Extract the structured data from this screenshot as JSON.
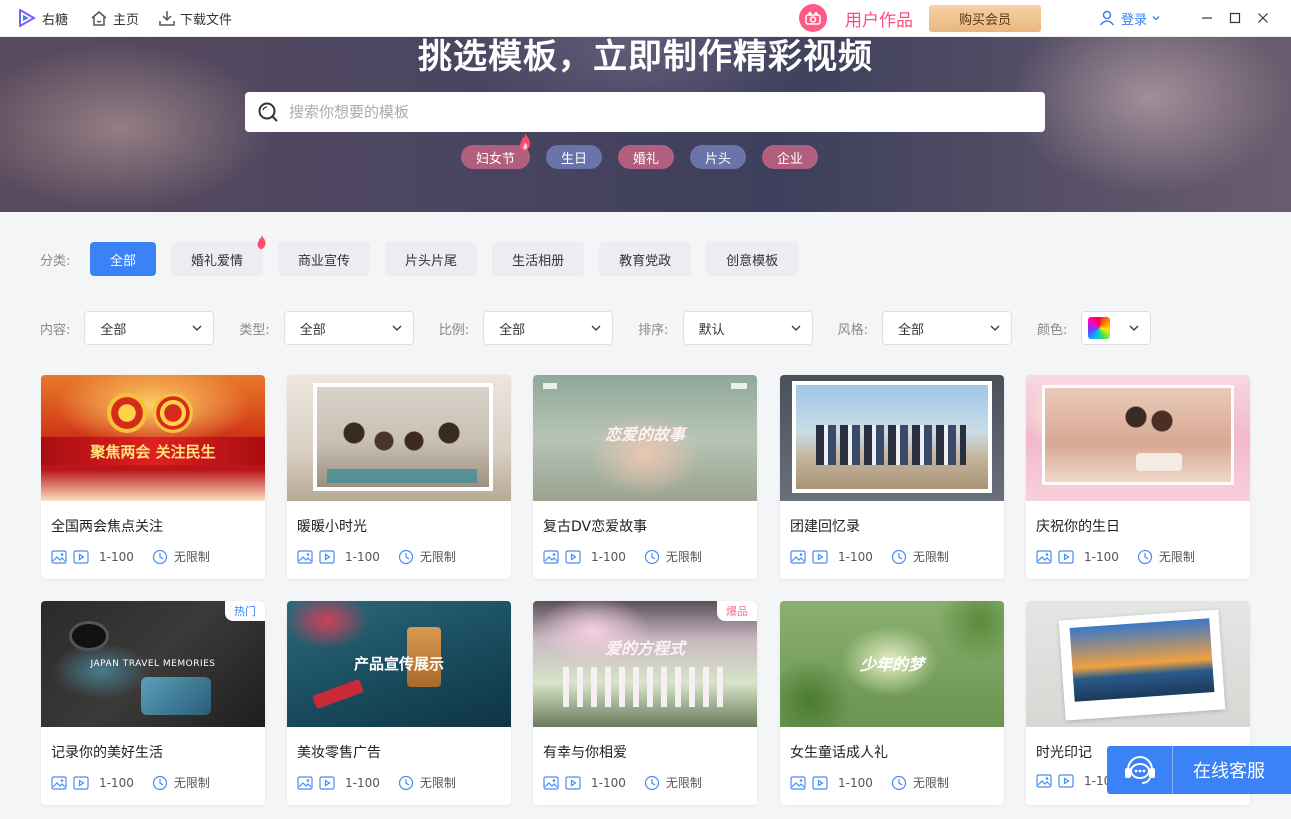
{
  "titlebar": {
    "app_name": "右糖",
    "home": "主页",
    "download": "下载文件",
    "user_works": "用户作品",
    "buy_vip": "购买会员",
    "login": "登录"
  },
  "banner": {
    "title": "挑选模板，立即制作精彩视频",
    "search_placeholder": "搜索你想要的模板",
    "hot_tags": [
      {
        "label": "妇女节",
        "color": "#b0607e"
      },
      {
        "label": "生日",
        "color": "#6a74a8"
      },
      {
        "label": "婚礼",
        "color": "#b0607e"
      },
      {
        "label": "片头",
        "color": "#6a74a8"
      },
      {
        "label": "企业",
        "color": "#b0607e"
      }
    ]
  },
  "category": {
    "label": "分类:",
    "items": [
      "全部",
      "婚礼爱情",
      "商业宣传",
      "片头片尾",
      "生活相册",
      "教育党政",
      "创意模板"
    ]
  },
  "filters": [
    {
      "label": "内容:",
      "value": "全部"
    },
    {
      "label": "类型:",
      "value": "全部"
    },
    {
      "label": "比例:",
      "value": "全部"
    },
    {
      "label": "排序:",
      "value": "默认"
    },
    {
      "label": "风格:",
      "value": "全部"
    }
  ],
  "color_filter": {
    "label": "颜色:"
  },
  "cards": [
    {
      "title": "全国两会焦点关注",
      "count": "1-100",
      "duration": "无限制",
      "badge": "",
      "thumb_text": "聚焦两会 关注民生"
    },
    {
      "title": "暖暖小时光",
      "count": "1-100",
      "duration": "无限制",
      "badge": "",
      "thumb_text": ""
    },
    {
      "title": "复古DV恋爱故事",
      "count": "1-100",
      "duration": "无限制",
      "badge": "",
      "thumb_text": "恋爱的故事"
    },
    {
      "title": "团建回忆录",
      "count": "1-100",
      "duration": "无限制",
      "badge": "",
      "thumb_text": ""
    },
    {
      "title": "庆祝你的生日",
      "count": "1-100",
      "duration": "无限制",
      "badge": "",
      "thumb_text": ""
    },
    {
      "title": "记录你的美好生活",
      "count": "1-100",
      "duration": "无限制",
      "badge": "热门",
      "thumb_text": "JAPAN TRAVEL MEMORIES"
    },
    {
      "title": "美妆零售广告",
      "count": "1-100",
      "duration": "无限制",
      "badge": "",
      "thumb_text": "产品宣传展示"
    },
    {
      "title": "有幸与你相爱",
      "count": "1-100",
      "duration": "无限制",
      "badge": "爆品",
      "thumb_text": "爱的方程式"
    },
    {
      "title": "女生童话成人礼",
      "count": "1-100",
      "duration": "无限制",
      "badge": "",
      "thumb_text": "少年的梦"
    },
    {
      "title": "时光印记",
      "count": "1-10",
      "duration": "",
      "badge": "",
      "thumb_text": ""
    }
  ],
  "service": {
    "label": "在线客服"
  },
  "colors": {
    "accent": "#3b82f6",
    "pink": "#ff4b7d"
  }
}
